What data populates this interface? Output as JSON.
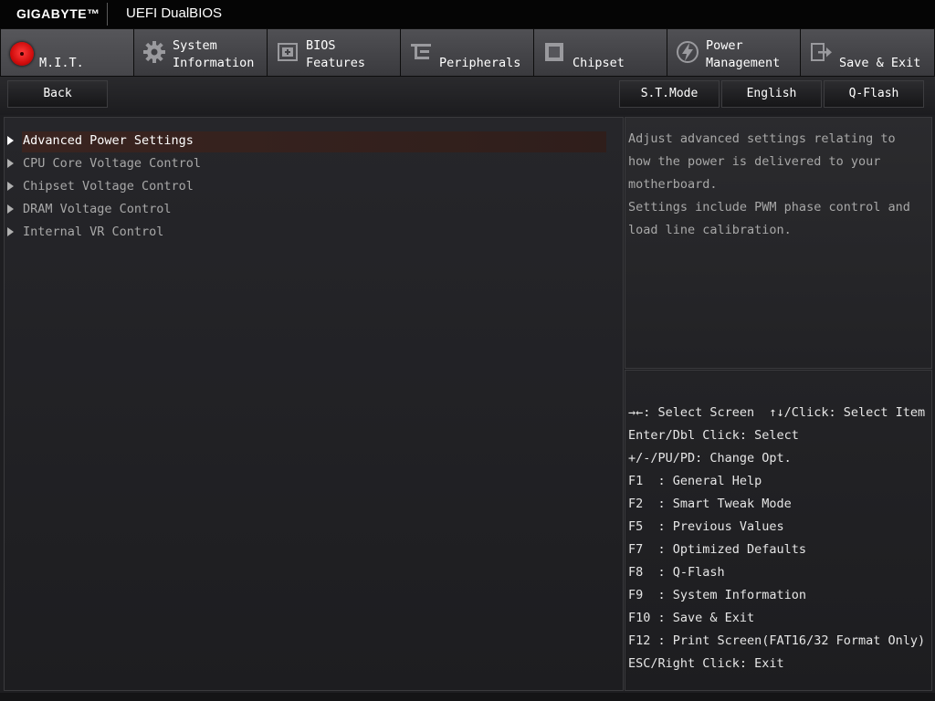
{
  "header": {
    "brand": "GIGABYTE™",
    "product": "UEFI DualBIOS"
  },
  "tabs": [
    {
      "line1": "M.I.T.",
      "line2": "",
      "icon": "mit-icon",
      "active": true
    },
    {
      "line1": "System",
      "line2": "Information",
      "icon": "gear-icon"
    },
    {
      "line1": "BIOS",
      "line2": "Features",
      "icon": "bios-chip-icon"
    },
    {
      "line1": "Peripherals",
      "line2": "",
      "icon": "peripherals-icon"
    },
    {
      "line1": "Chipset",
      "line2": "",
      "icon": "chipset-icon"
    },
    {
      "line1": "Power",
      "line2": "Management",
      "icon": "lightning-icon"
    },
    {
      "line1": "Save & Exit",
      "line2": "",
      "icon": "exit-icon"
    }
  ],
  "buttons": {
    "back": "Back",
    "st_mode": "S.T.Mode",
    "language": "English",
    "qflash": "Q-Flash"
  },
  "menu": [
    {
      "label": "Advanced Power Settings",
      "selected": true
    },
    {
      "label": "CPU Core Voltage Control"
    },
    {
      "label": "Chipset Voltage Control"
    },
    {
      "label": "DRAM Voltage Control"
    },
    {
      "label": "Internal VR Control"
    }
  ],
  "help_text": [
    "Adjust advanced settings relating to",
    "how the power is delivered to your",
    "motherboard.",
    "Settings include PWM phase control and",
    "load line calibration."
  ],
  "key_help": [
    "→←: Select Screen  ↑↓/Click: Select Item",
    "Enter/Dbl Click: Select",
    "+/-/PU/PD: Change Opt.",
    "F1  : General Help",
    "F2  : Smart Tweak Mode",
    "F5  : Previous Values",
    "F7  : Optimized Defaults",
    "F8  : Q-Flash",
    "F9  : System Information",
    "F10 : Save & Exit",
    "F12 : Print Screen(FAT16/32 Format Only)",
    "ESC/Right Click: Exit"
  ],
  "colors": {
    "accent_red": "#d10d0d",
    "selection": "#3a2420"
  }
}
